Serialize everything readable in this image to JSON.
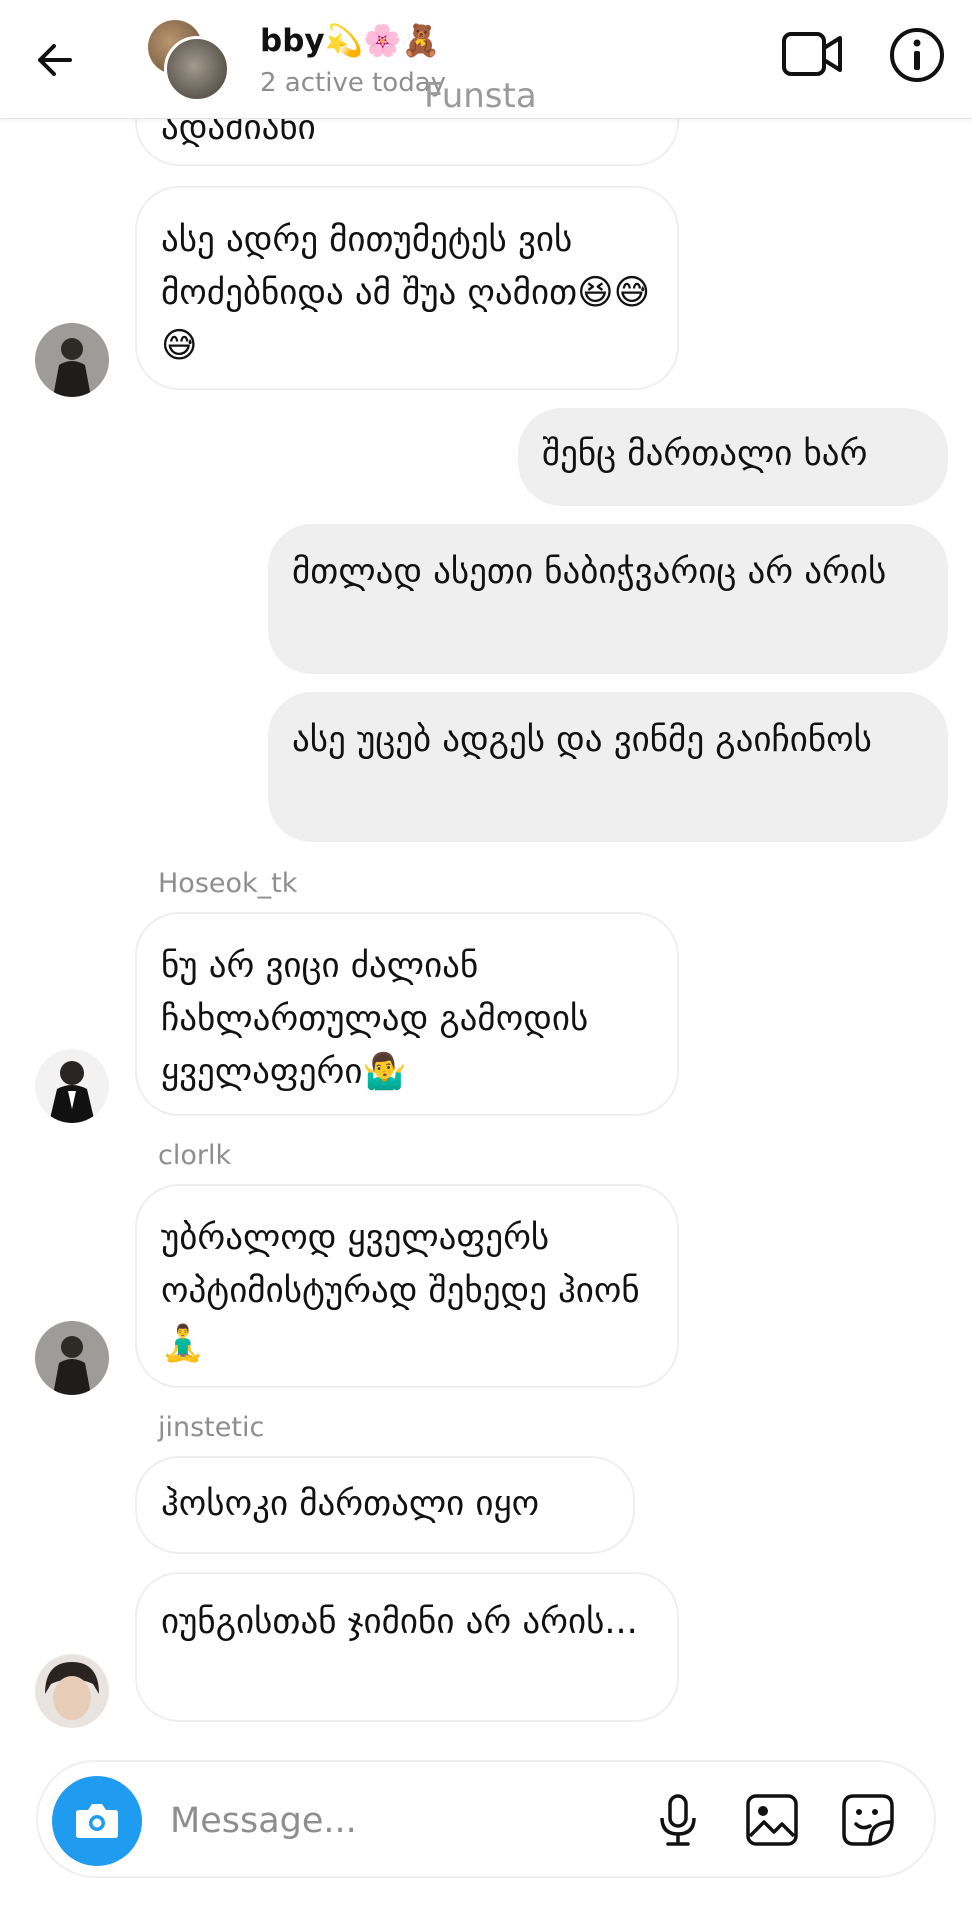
{
  "header": {
    "title": "bby💫🌸🧸",
    "status": "2 active today",
    "watermark": "Funsta"
  },
  "messages": [
    {
      "side": "in",
      "text": "ადამიანი"
    },
    {
      "side": "in",
      "text": "ასე ადრე მითუმეტეს ვის მოძებნიდა ამ შუა ღამით😆😅😅"
    },
    {
      "side": "out",
      "text": "შენც მართალი ხარ"
    },
    {
      "side": "out",
      "text": "მთლად ასეთი ნაბიჭვარიც არ არის"
    },
    {
      "side": "out",
      "text": "ასე უცებ ადგეს და ვინმე გაიჩინოს"
    },
    {
      "side": "in",
      "sender": "Hoseok_tk",
      "text": "ნუ არ ვიცი ძალიან ჩახლართულად გამოდის ყველაფერი🤷‍♂️"
    },
    {
      "side": "in",
      "sender": "clorlk",
      "text": "უბრალოდ ყველაფერს ოპტიმისტურად შეხედე ჰიონ🧘‍♂️"
    },
    {
      "side": "in",
      "sender": "jinstetic",
      "text": "ჰოსოკი მართალი იყო"
    },
    {
      "side": "in",
      "text": "იუნგისთან ჯიმინი არ არის..."
    }
  ],
  "composer": {
    "placeholder": "Message..."
  },
  "icons": {
    "back": "arrow-left-icon",
    "video": "video-camera-icon",
    "info": "info-icon",
    "camera": "camera-icon",
    "mic": "microphone-icon",
    "gallery": "image-icon",
    "sticker": "sticker-icon"
  },
  "colors": {
    "camera_button": "#1f9bf0",
    "outgoing_bubble": "#efefef",
    "incoming_border": "#efefef"
  }
}
